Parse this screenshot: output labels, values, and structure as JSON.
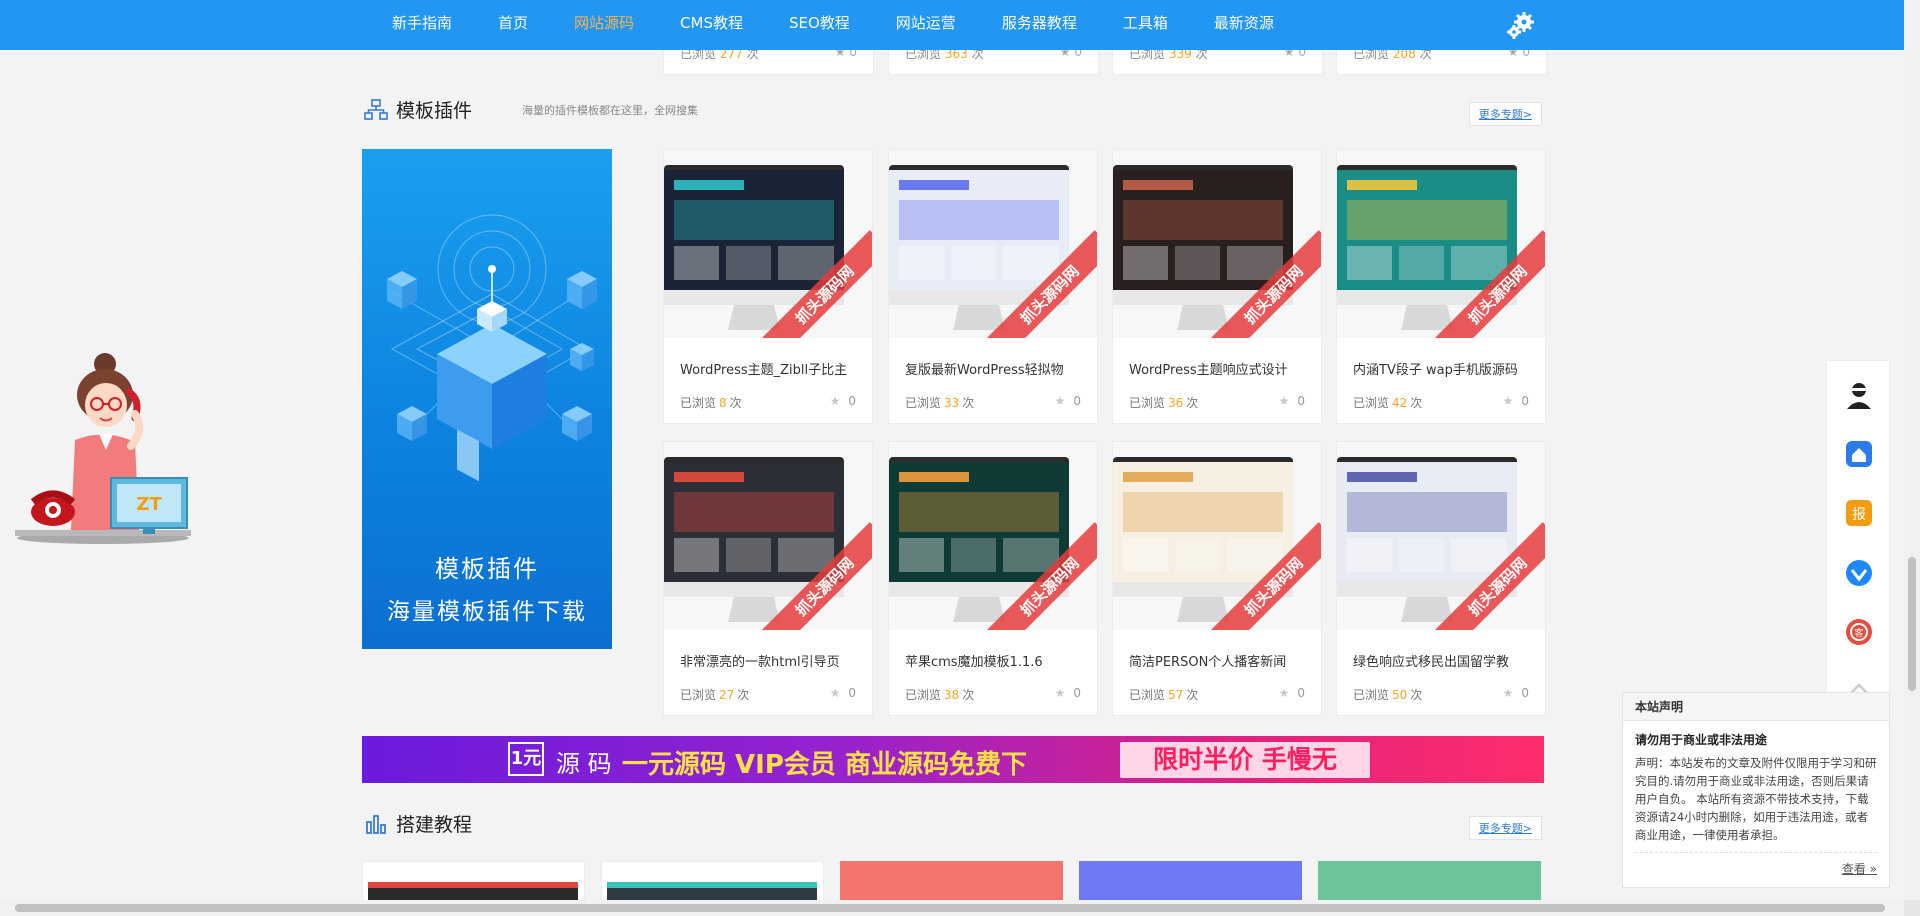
{
  "nav": {
    "items": [
      {
        "label": "新手指南",
        "active": false
      },
      {
        "label": "首页",
        "active": false
      },
      {
        "label": "网站源码",
        "active": true
      },
      {
        "label": "CMS教程",
        "active": false
      },
      {
        "label": "SEO教程",
        "active": false
      },
      {
        "label": "网站运营",
        "active": false
      },
      {
        "label": "服务器教程",
        "active": false
      },
      {
        "label": "工具箱",
        "active": false
      },
      {
        "label": "最新资源",
        "active": false
      }
    ],
    "settings_icon": "gear-icon"
  },
  "prev_cards": [
    {
      "views_label": "已浏览",
      "views": "277",
      "unit": "次",
      "favs": "0"
    },
    {
      "views_label": "已浏览",
      "views": "363",
      "unit": "次",
      "favs": "0"
    },
    {
      "views_label": "已浏览",
      "views": "339",
      "unit": "次",
      "favs": "0"
    },
    {
      "views_label": "已浏览",
      "views": "208",
      "unit": "次",
      "favs": "0"
    }
  ],
  "section_templates": {
    "title": "模板插件",
    "subtitle": "海量的插件模板都在这里，全网搜集",
    "more": "更多专题>",
    "banner_line1": "模板插件",
    "banner_line2": "海量模板插件下载"
  },
  "watermark": "抓头源码网",
  "cards": [
    {
      "title": "WordPress主题_Zibll子比主",
      "views_label": "已浏览",
      "views": "8",
      "unit": "次",
      "favs": "0",
      "screen": "#1b2436",
      "accent": "#2fc3c9"
    },
    {
      "title": "复版最新WordPress轻拟物",
      "views_label": "已浏览",
      "views": "33",
      "unit": "次",
      "favs": "0",
      "screen": "#e8ecf7",
      "accent": "#5b6ef0"
    },
    {
      "title": "WordPress主题响应式设计",
      "views_label": "已浏览",
      "views": "36",
      "unit": "次",
      "favs": "0",
      "screen": "#2a1f1f",
      "accent": "#c0614a"
    },
    {
      "title": "内涵TV段子 wap手机版源码",
      "views_label": "已浏览",
      "views": "42",
      "unit": "次",
      "favs": "0",
      "screen": "#1a8d87",
      "accent": "#f4c73b"
    },
    {
      "title": "非常漂亮的一款html引导页",
      "views_label": "已浏览",
      "views": "27",
      "unit": "次",
      "favs": "0",
      "screen": "#2d2f36",
      "accent": "#e84c3d"
    },
    {
      "title": "苹果cms魔加模板1.1.6",
      "views_label": "已浏览",
      "views": "38",
      "unit": "次",
      "favs": "0",
      "screen": "#0f3b36",
      "accent": "#f2a03d"
    },
    {
      "title": "简洁PERSON个人播客新闻",
      "views_label": "已浏览",
      "views": "57",
      "unit": "次",
      "favs": "0",
      "screen": "#f6efe2",
      "accent": "#e0a34f"
    },
    {
      "title": "绿色响应式移民出国留学教",
      "views_label": "已浏览",
      "views": "50",
      "unit": "次",
      "favs": "0",
      "screen": "#e9ebf4",
      "accent": "#5159a8"
    }
  ],
  "vip_banner": {
    "badge": "1元",
    "prefix": "源 码",
    "headline": "一元源码 VIP会员  商业源码免费下",
    "pill": "限时半价 手慢无"
  },
  "section_tutorials": {
    "title": "搭建教程",
    "more": "更多专题>"
  },
  "bottom_cards": [
    {
      "color": "#2b2b2b"
    },
    {
      "color": "#2f3a44"
    },
    {
      "color": "#f3766e"
    },
    {
      "color": "#6d78f2"
    },
    {
      "color": "#6cc59a"
    }
  ],
  "side_toolbar": [
    {
      "icon": "customer-service-icon",
      "color": "#222222"
    },
    {
      "icon": "home-icon",
      "color": "#2b7ce8"
    },
    {
      "icon": "report-icon",
      "color": "#f39c12"
    },
    {
      "icon": "vip-diamond-icon",
      "color": "#1e88ff"
    },
    {
      "icon": "red-envelope-icon",
      "color": "#e74c3c"
    },
    {
      "icon": "back-to-top-icon",
      "color": "#cccccc"
    }
  ],
  "notice": {
    "header": "本站声明",
    "title": "请勿用于商业或非法用途",
    "body": "声明：本站发布的文章及附件仅限用于学习和研究目的.请勿用于商业或非法用途，否则后果请用户自负。 本站所有资源不带技术支持，下载资源请24小时内删除，如用于违法用途，或者商业用途，一律使用者承担。",
    "footer": "查看 »"
  },
  "lady_sign": "ZT"
}
